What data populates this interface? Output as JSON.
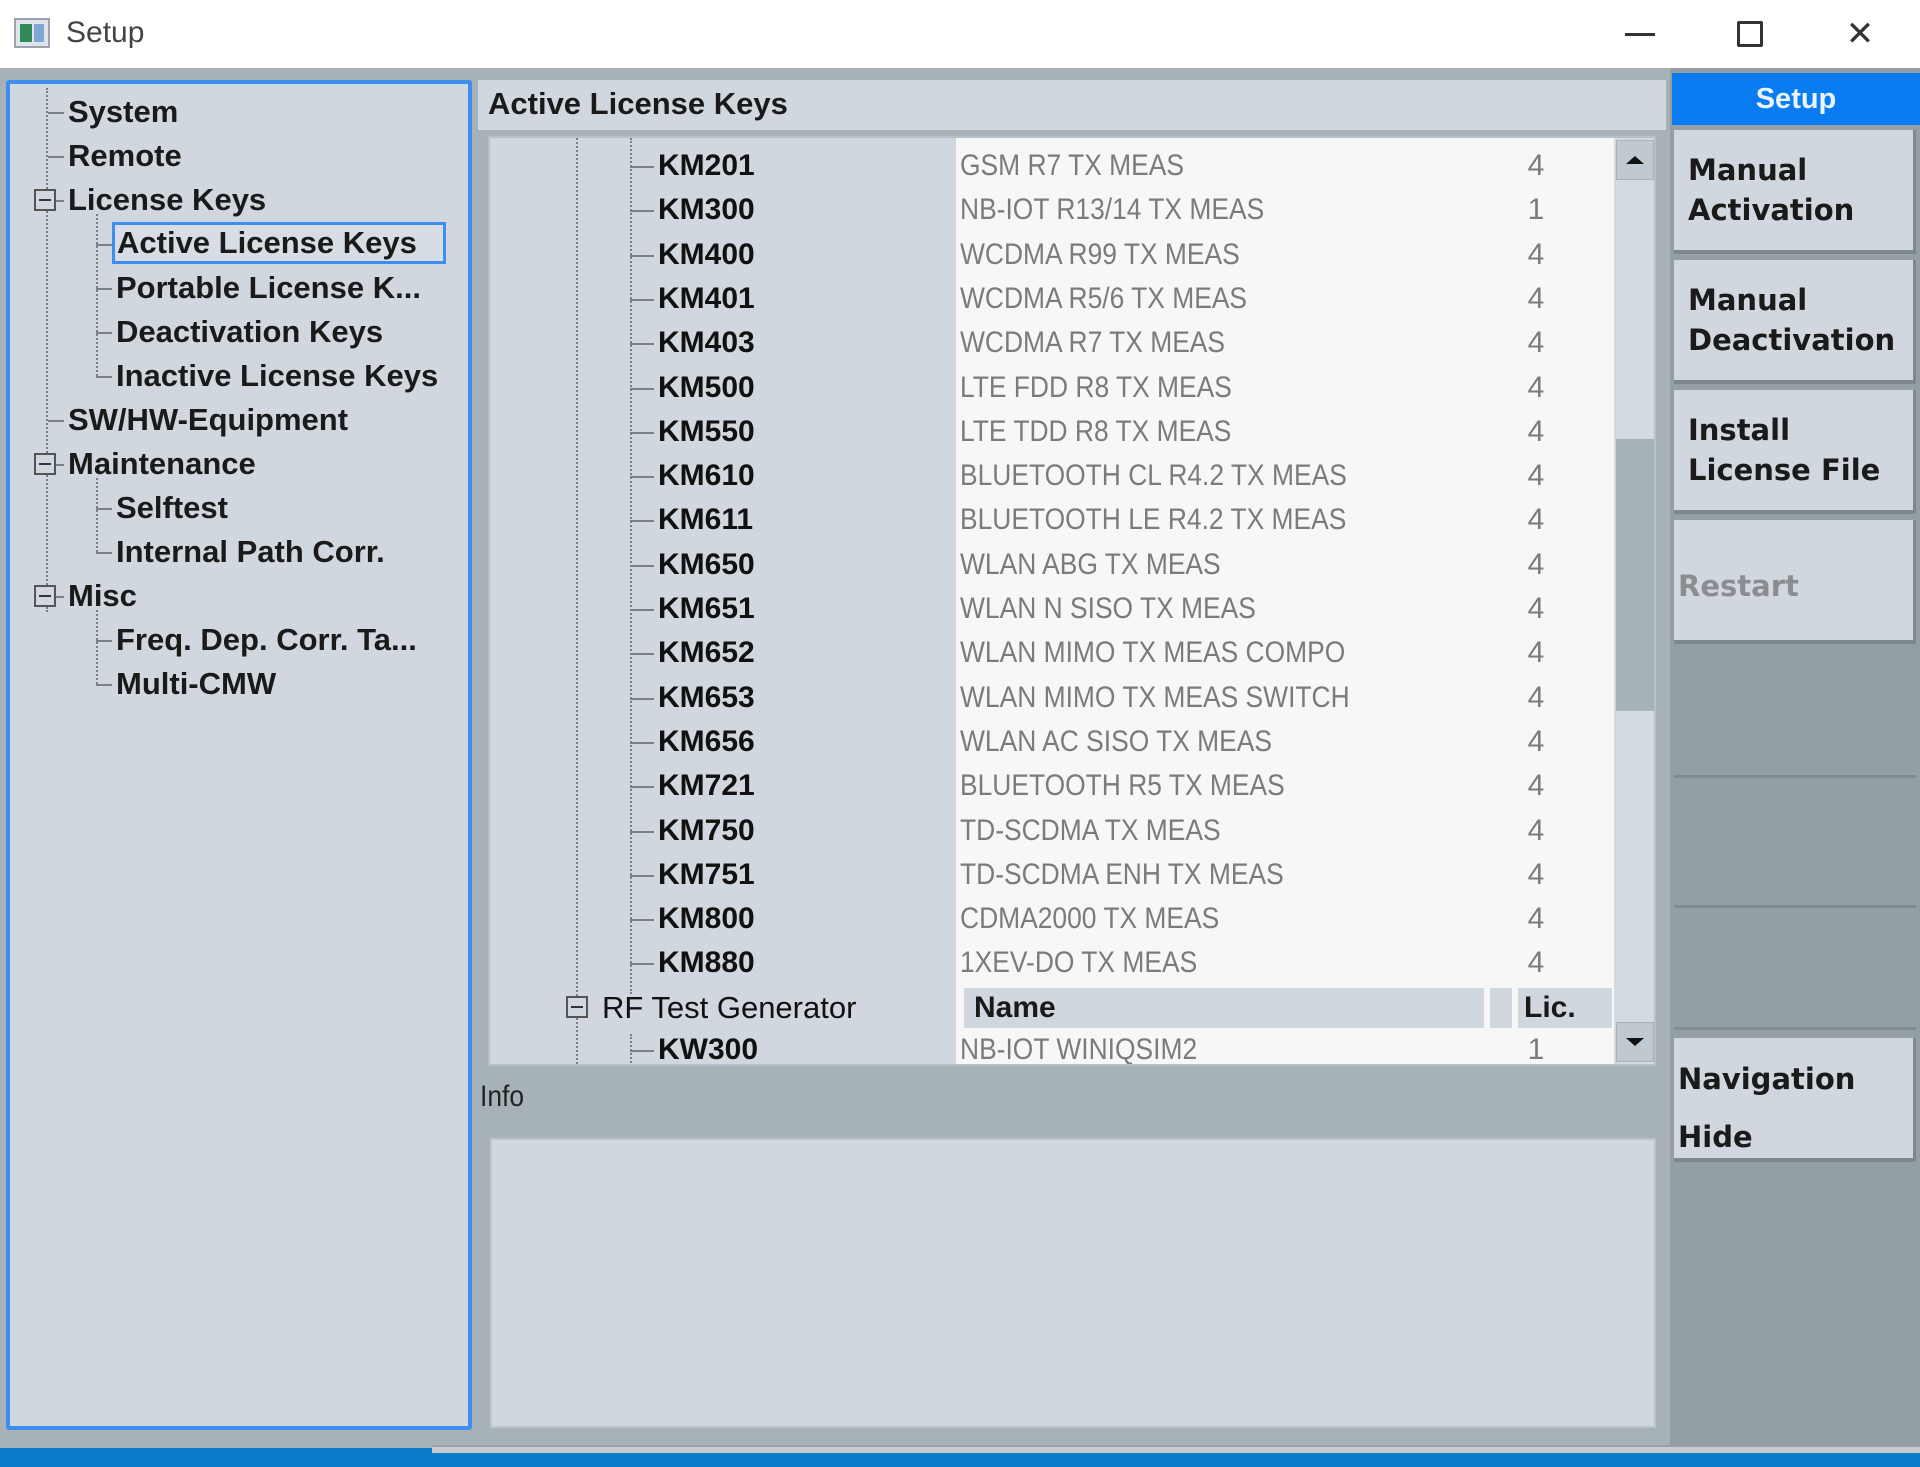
{
  "window": {
    "title": "Setup",
    "controls": {
      "minimize": "minimize",
      "maximize": "maximize",
      "close": "close"
    }
  },
  "nav_tree": {
    "items": [
      {
        "label": "System",
        "level": 0,
        "expandable": false
      },
      {
        "label": "Remote",
        "level": 0,
        "expandable": false
      },
      {
        "label": "License Keys",
        "level": 0,
        "expandable": true,
        "expanded": true
      },
      {
        "label": "Active License Keys",
        "level": 1,
        "selected": true
      },
      {
        "label": "Portable License K...",
        "level": 1
      },
      {
        "label": "Deactivation Keys",
        "level": 1
      },
      {
        "label": "Inactive License Keys",
        "level": 1
      },
      {
        "label": "SW/HW-Equipment",
        "level": 0,
        "expandable": false
      },
      {
        "label": "Maintenance",
        "level": 0,
        "expandable": true,
        "expanded": true
      },
      {
        "label": "Selftest",
        "level": 1
      },
      {
        "label": "Internal Path Corr.",
        "level": 1
      },
      {
        "label": "Misc",
        "level": 0,
        "expandable": true,
        "expanded": true
      },
      {
        "label": "Freq. Dep. Corr. Ta...",
        "level": 1
      },
      {
        "label": "Multi-CMW",
        "level": 1
      }
    ]
  },
  "main": {
    "title": "Active License Keys",
    "keys": [
      {
        "key": "KM201",
        "name": "GSM R7 TX MEAS",
        "lic": "4"
      },
      {
        "key": "KM300",
        "name": "NB-IOT R13/14 TX MEAS",
        "lic": "1"
      },
      {
        "key": "KM400",
        "name": "WCDMA R99 TX MEAS",
        "lic": "4"
      },
      {
        "key": "KM401",
        "name": "WCDMA R5/6 TX MEAS",
        "lic": "4"
      },
      {
        "key": "KM403",
        "name": "WCDMA R7 TX MEAS",
        "lic": "4"
      },
      {
        "key": "KM500",
        "name": "LTE FDD R8 TX MEAS",
        "lic": "4"
      },
      {
        "key": "KM550",
        "name": "LTE TDD R8 TX MEAS",
        "lic": "4"
      },
      {
        "key": "KM610",
        "name": "BLUETOOTH CL R4.2 TX MEAS",
        "lic": "4"
      },
      {
        "key": "KM611",
        "name": "BLUETOOTH LE R4.2 TX MEAS",
        "lic": "4"
      },
      {
        "key": "KM650",
        "name": "WLAN ABG TX MEAS",
        "lic": "4"
      },
      {
        "key": "KM651",
        "name": "WLAN N SISO TX MEAS",
        "lic": "4"
      },
      {
        "key": "KM652",
        "name": "WLAN MIMO TX MEAS COMPO",
        "lic": "4"
      },
      {
        "key": "KM653",
        "name": "WLAN MIMO TX MEAS SWITCH",
        "lic": "4"
      },
      {
        "key": "KM656",
        "name": "WLAN AC SISO TX MEAS",
        "lic": "4"
      },
      {
        "key": "KM721",
        "name": "BLUETOOTH R5 TX MEAS",
        "lic": "4"
      },
      {
        "key": "KM750",
        "name": "TD-SCDMA TX MEAS",
        "lic": "4"
      },
      {
        "key": "KM751",
        "name": "TD-SCDMA ENH TX MEAS",
        "lic": "4"
      },
      {
        "key": "KM800",
        "name": "CDMA2000 TX MEAS",
        "lic": "4"
      },
      {
        "key": "KM880",
        "name": "1XEV-DO TX MEAS",
        "lic": "4"
      }
    ],
    "group": {
      "label": "RF Test Generator",
      "col_name": "Name",
      "col_lic": "Lic.",
      "rows": [
        {
          "key": "KW300",
          "name": "NB-IOT WINIQSIM2",
          "lic": "1"
        }
      ]
    },
    "scroll_position": 0.45,
    "info_label": "Info",
    "info_text": ""
  },
  "softkeys": {
    "header": "Setup",
    "buttons": [
      {
        "label": "Manual\nActivation",
        "enabled": true
      },
      {
        "label": "Manual\nDeactivation",
        "enabled": true
      },
      {
        "label": "Install\nLicense File",
        "enabled": true
      },
      {
        "label": "Restart",
        "enabled": false
      }
    ],
    "navigation": {
      "line1": "Navigation",
      "line2": "Hide"
    }
  },
  "colors": {
    "accent": "#0a7cf2",
    "selection_border": "#3d8ef0",
    "panel_bg": "#d0d7de",
    "softkey_bg": "#939ea5"
  }
}
